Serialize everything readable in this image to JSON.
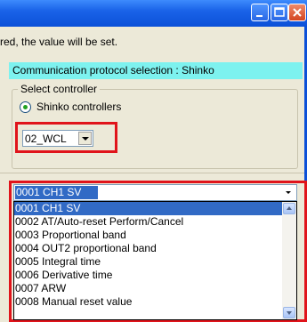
{
  "window": {
    "buttons": [
      "minimize-icon",
      "maximize-icon",
      "close-icon"
    ]
  },
  "info_text": "red, the value will be set.",
  "protocol_bar": {
    "text": "Communication protocol selection : Shinko",
    "color": "#7df2ef"
  },
  "controller_group": {
    "legend": "Select controller",
    "radio_label": "Shinko controllers",
    "select_value": "02_WCL"
  },
  "parameter_combo": {
    "selected": "0001 CH1 SV",
    "items": [
      "0001 CH1 SV",
      "0002 AT/Auto-reset Perform/Cancel",
      "0003 Proportional band",
      "0004 OUT2 proportional band",
      "0005 Integral time",
      "0006 Derivative time",
      "0007 ARW",
      "0008 Manual reset value"
    ],
    "highlighted_index": 0
  },
  "colors": {
    "highlight_box": "#e0141b",
    "selection": "#316ac5"
  }
}
